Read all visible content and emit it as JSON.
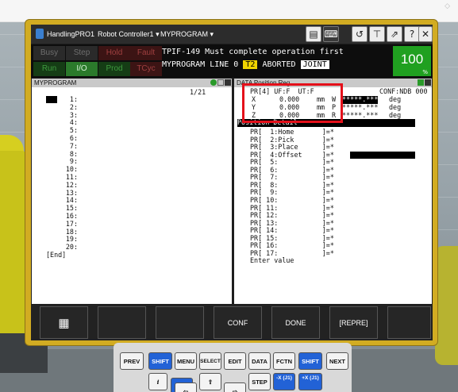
{
  "window": {
    "app": "HandlingPRO1",
    "controller": "Robot Controller1",
    "program_menu": "MYPROGRAM"
  },
  "status": {
    "leds": [
      "Busy",
      "Step",
      "Hold",
      "Fault",
      "Run",
      "I/O",
      "Prod",
      "TCyc"
    ],
    "message_line1": "TPIF-149 Must complete operation first",
    "message_line2_prefix": "MYPROGRAM LINE 0",
    "message_chip_mode": "T2",
    "message_state": "ABORTED",
    "message_chip_coord": "JOINT",
    "override": "100",
    "override_unit": "%"
  },
  "left_pane": {
    "title": "MYPROGRAM",
    "position": "1/21",
    "lines": [
      "1:",
      "2:",
      "3:",
      "4:",
      "5:",
      "6:",
      "7:",
      "8:",
      "9:",
      "10:",
      "11:",
      "12:",
      "13:",
      "14:",
      "15:",
      "16:",
      "17:",
      "18:",
      "19:",
      "20:",
      "[End]"
    ]
  },
  "right_pane": {
    "title": "DATA Position Reg",
    "header": "PR[4] UF:F  UT:F",
    "conf": "CONF:NDB 000",
    "xyz": [
      {
        "axis": "X",
        "value": "0.000",
        "unit": "mm",
        "rot": "W",
        "rot_value": "*****.***",
        "rot_unit": "deg"
      },
      {
        "axis": "Y",
        "value": "0.000",
        "unit": "mm",
        "rot": "P",
        "rot_value": "*****.***",
        "rot_unit": "deg"
      },
      {
        "axis": "Z",
        "value": "0.000",
        "unit": "mm",
        "rot": "R",
        "rot_value": "*****.***",
        "rot_unit": "deg"
      }
    ],
    "detail_title": "Position Detail",
    "registers": [
      {
        "label": "PR[  1:Home       ]=*"
      },
      {
        "label": "PR[  2:Pick       ]=*"
      },
      {
        "label": "PR[  3:Place      ]=*"
      },
      {
        "label": "PR[  4:Offset     ]=*"
      },
      {
        "label": "PR[  5:           ]=*"
      },
      {
        "label": "PR[  6:           ]=*"
      },
      {
        "label": "PR[  7:           ]=*"
      },
      {
        "label": "PR[  8:           ]=*"
      },
      {
        "label": "PR[  9:           ]=*"
      },
      {
        "label": "PR[ 10:           ]=*"
      },
      {
        "label": "PR[ 11:           ]=*"
      },
      {
        "label": "PR[ 12:           ]=*"
      },
      {
        "label": "PR[ 13:           ]=*"
      },
      {
        "label": "PR[ 14:           ]=*"
      },
      {
        "label": "PR[ 15:           ]=*"
      },
      {
        "label": "PR[ 16:           ]=*"
      },
      {
        "label": "PR[ 17:           ]=*"
      }
    ],
    "prompt": "Enter value"
  },
  "softkeys": [
    "",
    "",
    "",
    "CONF",
    "DONE",
    "[REPRE]",
    ""
  ],
  "keypad": {
    "row1": [
      "PREV",
      "SHIFT",
      "MENU",
      "SELECT",
      "EDIT",
      "DATA",
      "FCTN",
      "SHIFT",
      "NEXT"
    ],
    "row2": [
      "i",
      "",
      "",
      "",
      "",
      "STEP",
      "-X (J1)",
      "+X (J1)"
    ]
  },
  "colors": {
    "led_active": "#1f7a1f",
    "led_inactive_hold": "#5a1a1a",
    "override_bg": "#20a020",
    "highlight": "#e4101a",
    "pendant": "#d2ac22"
  }
}
